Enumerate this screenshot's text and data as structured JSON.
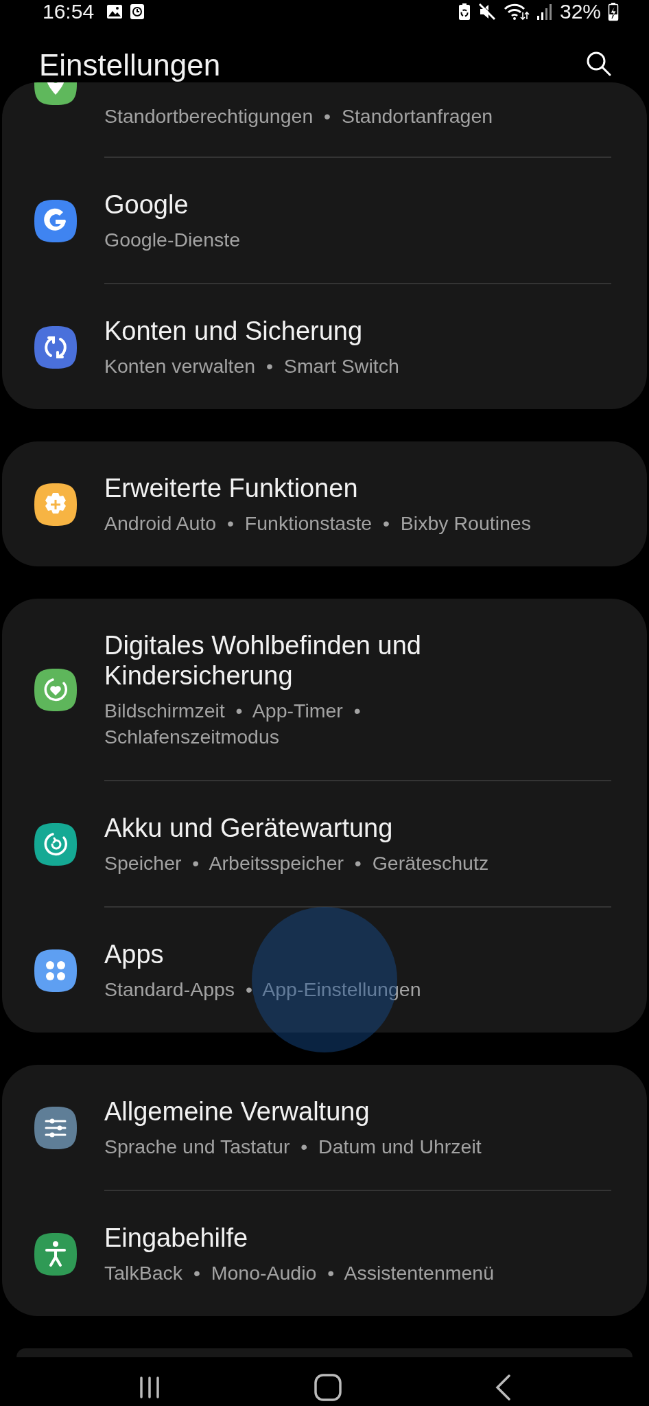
{
  "status_bar": {
    "time": "16:54",
    "battery": "32%"
  },
  "header": {
    "title": "Einstellungen"
  },
  "groups": [
    {
      "items": [
        {
          "kind": "location",
          "color": "#5fb85c",
          "subtitle": "Standortberechtigungen  •  Standortanfragen"
        },
        {
          "kind": "google",
          "color": "#3f84f1",
          "title": "Google",
          "subtitle": "Google-Dienste"
        },
        {
          "kind": "sync",
          "color": "#4a70db",
          "title": "Konten und Sicherung",
          "subtitle": "Konten verwalten  •  Smart Switch"
        }
      ]
    },
    {
      "items": [
        {
          "kind": "feature",
          "color": "#f7b443",
          "title": "Erweiterte Funktionen",
          "subtitle": "Android Auto  •  Funktionstaste  •  Bixby Routines"
        }
      ]
    },
    {
      "items": [
        {
          "kind": "wellbeing",
          "color": "#5eb65b",
          "title": "Digitales Wohlbefinden und\nKindersicherung",
          "subtitle": "Bildschirmzeit  •  App-Timer  •\nSchlafenszeitmodus"
        },
        {
          "kind": "care",
          "color": "#15a994",
          "title": "Akku und Gerätewartung",
          "subtitle": "Speicher  •  Arbeitsspeicher  •  Geräteschutz"
        },
        {
          "kind": "apps",
          "color": "#5e9ff2",
          "title": "Apps",
          "subtitle": "Standard-Apps  •  App-Einstellungen"
        }
      ]
    },
    {
      "items": [
        {
          "kind": "management",
          "color": "#5f7e97",
          "title": "Allgemeine Verwaltung",
          "subtitle": "Sprache und Tastatur  •  Datum und Uhrzeit"
        },
        {
          "kind": "accessibility",
          "color": "#2f9a55",
          "title": "Eingabehilfe",
          "subtitle": "TalkBack  •  Mono-Audio  •  Assistentenmenü"
        }
      ]
    }
  ],
  "touch_indicator": {
    "visible": true
  }
}
